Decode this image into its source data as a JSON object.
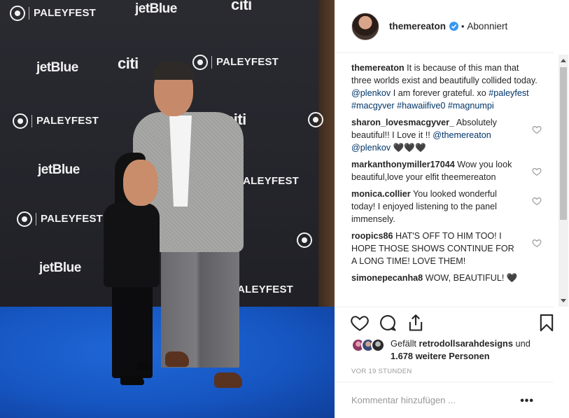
{
  "photo": {
    "backdrop_logos": {
      "paleyfest": "PALEYFEST",
      "jetblue": "jetBlue",
      "citi": "citi"
    }
  },
  "header": {
    "username": "themereaton",
    "verified_icon": "verified-badge-icon",
    "separator": "•",
    "follow_state": "Abonniert"
  },
  "caption": {
    "username": "themereaton",
    "text_before": " It is because of this man that three worlds exist and beautifully collided today. ",
    "mention": "@plenkov",
    "text_after": " I am forever grateful. xo ",
    "hashtags": "#paleyfest #macgyver #hawaiifive0 #magnumpi"
  },
  "comments": [
    {
      "username": "sharon_lovesmacgyver_",
      "text": " Absolutely beautiful!! I Love it !! ",
      "mentions": "@themereaton @plenkov",
      "emoji": " 🖤🖤🖤"
    },
    {
      "username": "markanthonymiller17044",
      "text": " Wow you look beautiful,love your elfit theemereaton"
    },
    {
      "username": "monica.collier",
      "text": " You looked wonderful today! I enjoyed listening to the panel immensely."
    },
    {
      "username": "roopics86",
      "text": " HAT'S OFF TO HIM TOO! I HOPE THOSE SHOWS CONTINUE FOR A LONG TIME! LOVE THEM!"
    },
    {
      "username": "simonepecanha8",
      "text": " WOW, BEAUTIFUL! 🖤"
    }
  ],
  "actions": {
    "like_icon": "heart-icon",
    "comment_icon": "comment-bubble-icon",
    "share_icon": "share-icon",
    "save_icon": "bookmark-icon"
  },
  "likes": {
    "prefix": "Gefällt ",
    "user": "retrodollsarahdesigns",
    "middle": " und ",
    "count": "1.678 weitere Personen"
  },
  "timestamp": "VOR 19 STUNDEN",
  "add_comment": {
    "placeholder": "Kommentar hinzufügen ...",
    "more_label": "•••"
  },
  "colors": {
    "link": "#003569",
    "verified": "#3897f0",
    "carpet": "#1656c2"
  }
}
